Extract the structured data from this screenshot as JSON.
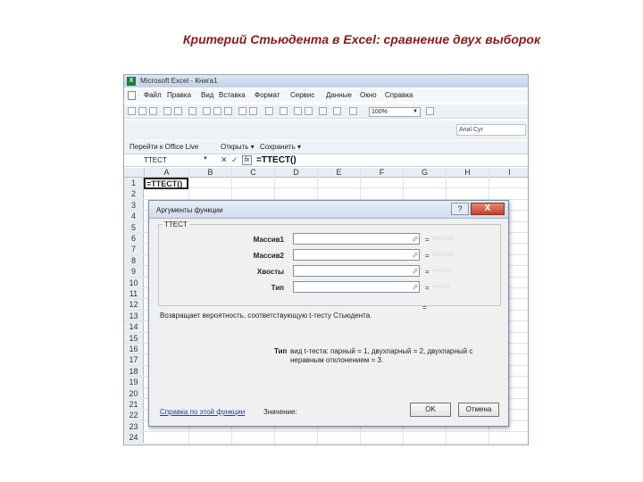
{
  "slide": {
    "title": "Критерий Стьюдента в Excel: сравнение двух выборок"
  },
  "window": {
    "title": "Microsoft Excel - Книга1",
    "app_icon": "X"
  },
  "menu": {
    "items": [
      "Файл",
      "Правка",
      "Вид",
      "Вставка",
      "Формат",
      "Сервис",
      "Данные",
      "Окно",
      "Справка"
    ]
  },
  "toolbar": {
    "zoom": "100%",
    "font": "Arial Cyr"
  },
  "office_live": {
    "items": [
      "Перейти к Office Live",
      "Открыть ▾",
      "Сохранить ▾"
    ]
  },
  "formula_bar": {
    "name_box": "TTECT",
    "fx": "fx",
    "formula": "=TTECT()"
  },
  "grid": {
    "columns": [
      "A",
      "B",
      "C",
      "D",
      "E",
      "F",
      "G",
      "H",
      "I"
    ],
    "rows": [
      "1",
      "2",
      "3",
      "4",
      "5",
      "6",
      "7",
      "8",
      "9",
      "10",
      "11",
      "12",
      "13",
      "14",
      "15",
      "16",
      "17",
      "18",
      "19",
      "20",
      "21",
      "22",
      "23",
      "24"
    ],
    "cell_a1": "=TTECT()"
  },
  "dialog": {
    "title": "Аргументы функции",
    "function_name": "TTECT",
    "args": [
      {
        "label": "Массив1",
        "hint": "массив"
      },
      {
        "label": "Массив2",
        "hint": "массив"
      },
      {
        "label": "Хвосты",
        "hint": "число"
      },
      {
        "label": "Тип",
        "hint": "число"
      }
    ],
    "equals": "=",
    "description": "Возвращает вероятность, соответствующую t-тесту Стьюдента.",
    "arg_desc_label": "Тип",
    "arg_desc_text": "вид t-теста: парный = 1, двухпарный = 2, двухпарный с неравным отклонением = 3.",
    "help_link": "Справка по этой функции",
    "value_label": "Значение:",
    "ok": "OK",
    "cancel": "Отмена",
    "help_btn": "?",
    "close_btn": "X"
  }
}
